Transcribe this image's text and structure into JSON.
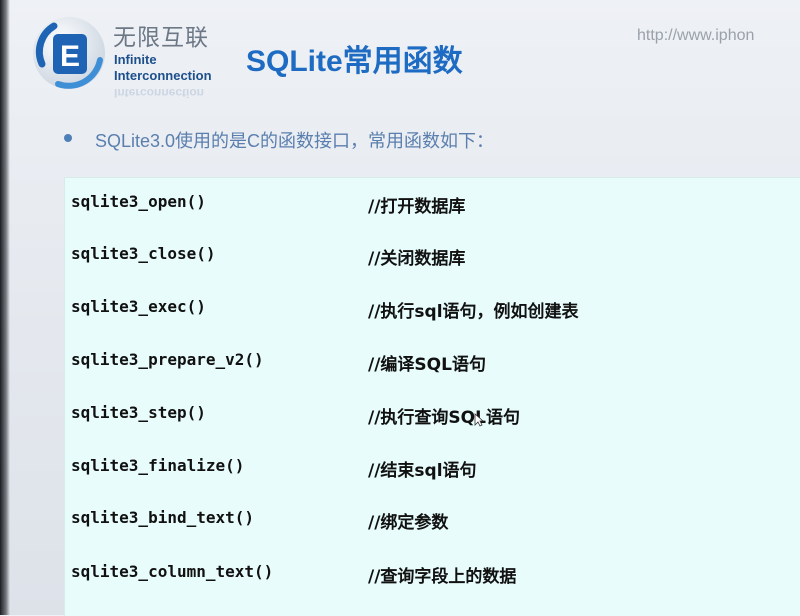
{
  "header": {
    "brand_cn": "无限互联",
    "brand_en_line1": "Infinite",
    "brand_en_line2": "Interconnection",
    "brand_reflection": "Interconnection",
    "logo_letter": "E",
    "title": "SQLite常用函数",
    "url": "http://www.iphon"
  },
  "intro": "SQLite3.0使用的是C的函数接口，常用函数如下：",
  "functions": [
    {
      "name": "sqlite3_open()",
      "comment": "//打开数据库"
    },
    {
      "name": "sqlite3_close()",
      "comment": "//关闭数据库"
    },
    {
      "name": "sqlite3_exec()",
      "comment": "//执行sql语句，例如创建表"
    },
    {
      "name": "sqlite3_prepare_v2()",
      "comment": "//编译SQL语句"
    },
    {
      "name": "sqlite3_step()",
      "comment": "//执行查询SQL语句"
    },
    {
      "name": "sqlite3_finalize()",
      "comment": "//结束sql语句"
    },
    {
      "name": "sqlite3_bind_text()",
      "comment": "//绑定参数"
    },
    {
      "name": "sqlite3_column_text()",
      "comment": "//查询字段上的数据"
    }
  ],
  "colors": {
    "title": "#1d6bc2",
    "intro": "#5a7fae",
    "code_bg": "#e7fcfb",
    "logo_blue": "#1f64b4"
  }
}
